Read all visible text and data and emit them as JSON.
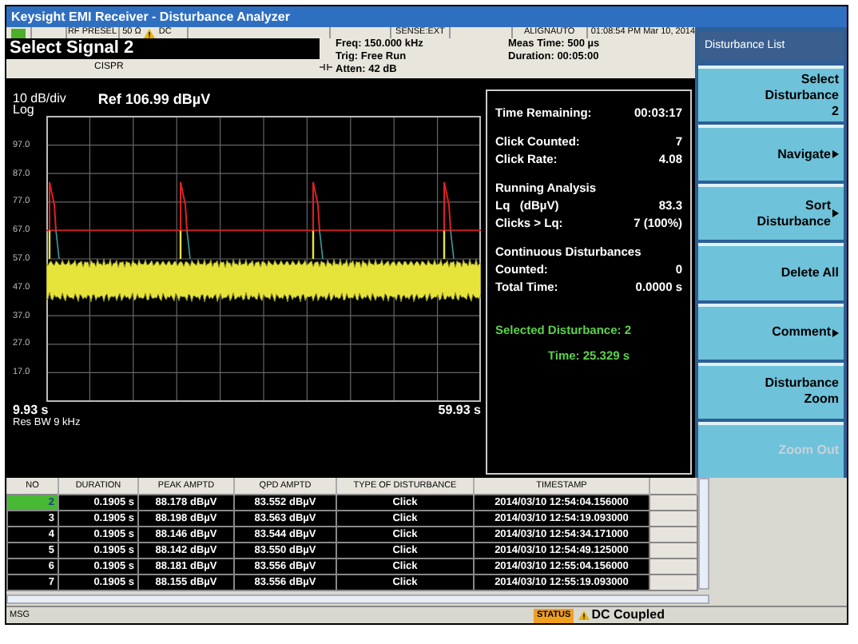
{
  "window": {
    "title": "Keysight EMI Receiver - Disturbance Analyzer"
  },
  "status_row": {
    "input": "RF PRESEL",
    "impedance": "50 Ω",
    "coupling": "DC",
    "sense": "SENSE:EXT",
    "align": "ALIGNAUTO",
    "datetime": "01:08:54 PM Mar 10, 2014"
  },
  "header": {
    "title": "Select Signal 2",
    "subtitle": "CISPR",
    "freq": "Freq: 150.000 kHz",
    "trig": "Trig: Free Run",
    "atten": "Atten: 42 dB",
    "meas_time": "Meas Time: 500 µs",
    "duration": "Duration: 00:05:00"
  },
  "chart": {
    "scale": "10 dB/div",
    "scale_type": "Log",
    "ref": "Ref 106.99 dBµV",
    "y_labels": [
      "97.0",
      "87.0",
      "77.0",
      "67.0",
      "57.0",
      "47.0",
      "37.0",
      "27.0",
      "17.0"
    ],
    "x_start": "9.93 s",
    "x_end": "59.93 s",
    "res_bw": "Res BW 9 kHz"
  },
  "info": {
    "items": [
      {
        "kind": "pair",
        "label": "Time Remaining:",
        "value": "00:03:17"
      },
      {
        "kind": "gap"
      },
      {
        "kind": "pair",
        "label": "Click Counted:",
        "value": "7"
      },
      {
        "kind": "pair",
        "label": "Click Rate:",
        "value": "4.08"
      },
      {
        "kind": "gap"
      },
      {
        "kind": "heading",
        "label": "Running Analysis"
      },
      {
        "kind": "pair",
        "label": "Lq   (dBµV)",
        "value": "83.3"
      },
      {
        "kind": "pair",
        "label": "Clicks > Lq:",
        "value": "7 (100%)"
      },
      {
        "kind": "gap"
      },
      {
        "kind": "heading",
        "label": "Continuous Disturbances"
      },
      {
        "kind": "pair",
        "label": "Counted:",
        "value": "0"
      },
      {
        "kind": "pair",
        "label": "Total Time:",
        "value": "0.0000 s"
      }
    ],
    "selected": "Selected Disturbance: 2",
    "time": "Time: 25.329 s"
  },
  "softkeys": {
    "title": "Disturbance List",
    "buttons": [
      {
        "label": "Select Disturbance",
        "value": "2",
        "submenu": false,
        "disabled": false
      },
      {
        "label": "Navigate",
        "submenu": true,
        "disabled": false
      },
      {
        "label": "Sort Disturbance",
        "submenu": true,
        "disabled": false
      },
      {
        "label": "Delete All",
        "submenu": false,
        "disabled": false
      },
      {
        "label": "Comment",
        "submenu": true,
        "disabled": false
      },
      {
        "label": "Disturbance Zoom",
        "submenu": false,
        "disabled": false
      },
      {
        "label": "Zoom Out",
        "submenu": false,
        "disabled": true
      }
    ]
  },
  "table": {
    "columns": [
      "NO",
      "DURATION",
      "PEAK AMPTD",
      "QPD AMPTD",
      "TYPE OF DISTURBANCE",
      "TIMESTAMP"
    ],
    "rows": [
      {
        "selected": true,
        "cells": [
          "2",
          "0.1905 s",
          "88.178 dBµV",
          "83.552 dBµV",
          "Click",
          "2014/03/10 12:54:04.156000"
        ]
      },
      {
        "selected": false,
        "cells": [
          "3",
          "0.1905 s",
          "88.198 dBµV",
          "83.563 dBµV",
          "Click",
          "2014/03/10 12:54:19.093000"
        ]
      },
      {
        "selected": false,
        "cells": [
          "4",
          "0.1905 s",
          "88.146 dBµV",
          "83.544 dBµV",
          "Click",
          "2014/03/10 12:54:34.171000"
        ]
      },
      {
        "selected": false,
        "cells": [
          "5",
          "0.1905 s",
          "88.142 dBµV",
          "83.550 dBµV",
          "Click",
          "2014/03/10 12:54:49.125000"
        ]
      },
      {
        "selected": false,
        "cells": [
          "6",
          "0.1905 s",
          "88.181 dBµV",
          "83.556 dBµV",
          "Click",
          "2014/03/10 12:55:04.156000"
        ]
      },
      {
        "selected": false,
        "cells": [
          "7",
          "0.1905 s",
          "88.155 dBµV",
          "83.556 dBµV",
          "Click",
          "2014/03/10 12:55:19.093000"
        ]
      }
    ]
  },
  "message_bar": {
    "label": "MSG",
    "status": "STATUS",
    "alert": "DC Coupled"
  }
}
